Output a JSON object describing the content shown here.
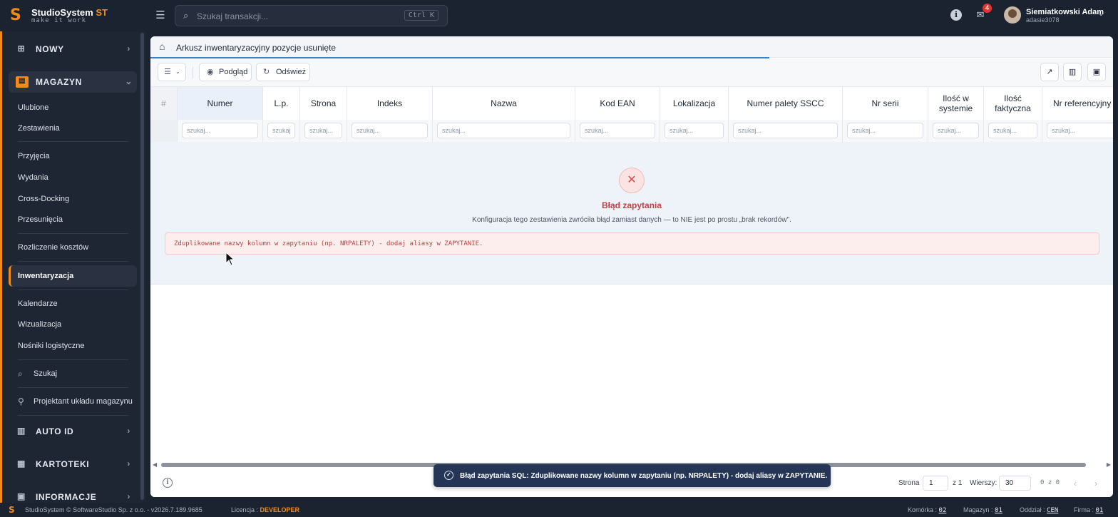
{
  "app": {
    "brand": "StudioSystem",
    "brand_suffix": "ST",
    "tagline": "make it work",
    "accent_color": "#f28a1a"
  },
  "topbar": {
    "search_placeholder": "Szukaj transakcji...",
    "search_shortcut": "Ctrl K",
    "notifications_count": "4",
    "user_name": "Siemiatkowski Adam",
    "user_login": "adasie3078"
  },
  "sidebar": {
    "groups": {
      "nowy": "NOWY",
      "magazyn": "MAGAZYN",
      "auto_id": "AUTO ID",
      "kartoteki": "KARTOTEKI",
      "informacje": "INFORMACJE"
    },
    "items": {
      "ulubione": "Ulubione",
      "zestawienia": "Zestawienia",
      "przyjecia": "Przyjęcia",
      "wydania": "Wydania",
      "cross_docking": "Cross-Docking",
      "przesuniecia": "Przesunięcia",
      "rozliczenie": "Rozliczenie kosztów",
      "inwentaryzacja": "Inwentaryzacja",
      "kalendarze": "Kalendarze",
      "wizualizacja": "Wizualizacja",
      "nosniki": "Nośniki logistyczne",
      "szukaj": "Szukaj",
      "projektant": "Projektant układu magazynu"
    }
  },
  "page": {
    "title": "Arkusz inwentaryzacyjny pozycje usunięte",
    "toolbar": {
      "preview_label": "Podgląd",
      "refresh_label": "Odśwież"
    },
    "filter_placeholder": "szukaj...",
    "filter_placeholder_short": "szukaj",
    "columns": {
      "numer": "Numer",
      "lp": "L.p.",
      "strona": "Strona",
      "indeks": "Indeks",
      "nazwa": "Nazwa",
      "kod_ean": "Kod EAN",
      "lokalizacja": "Lokalizacja",
      "numer_palety": "Numer palety SSCC",
      "nr_serii": "Nr serii",
      "ilosc_systemie": "Ilość w systemie",
      "ilosc_faktyczna": "Ilość faktyczna",
      "nr_referencyjny": "Nr referencyjny"
    },
    "error": {
      "title": "Błąd zapytania",
      "description": "Konfiguracja tego zestawienia zwróciła błąd zamiast danych — to NIE jest po prostu „brak rekordów\".",
      "message": "Zduplikowane nazwy kolumn w zapytaniu (np. NRPALETY) - dodaj aliasy w ZAPYTANIE."
    },
    "pagination": {
      "page_label": "Strona",
      "page_value": "1",
      "of_label": "z 1",
      "rows_label": "Wierszy:",
      "rows_value": "30",
      "count": "0 z 0"
    }
  },
  "toast": {
    "text": "Błąd zapytania SQL: Zduplikowane nazwy kolumn w zapytaniu (np. NRPALETY) - dodaj aliasy w ZAPYTANIE."
  },
  "statusbar": {
    "copyright": "StudioSystem © SoftwareStudio Sp. z o.o. - v2026.7.189.9685",
    "license_label": "Licencja :",
    "license_value": "DEVELOPER",
    "komorka_label": "Komórka :",
    "komorka_value": "02",
    "magazyn_label": "Magazyn :",
    "magazyn_value": "01",
    "oddzial_label": "Oddział :",
    "oddzial_value": "CEN",
    "firma_label": "Firma :",
    "firma_value": "01"
  }
}
